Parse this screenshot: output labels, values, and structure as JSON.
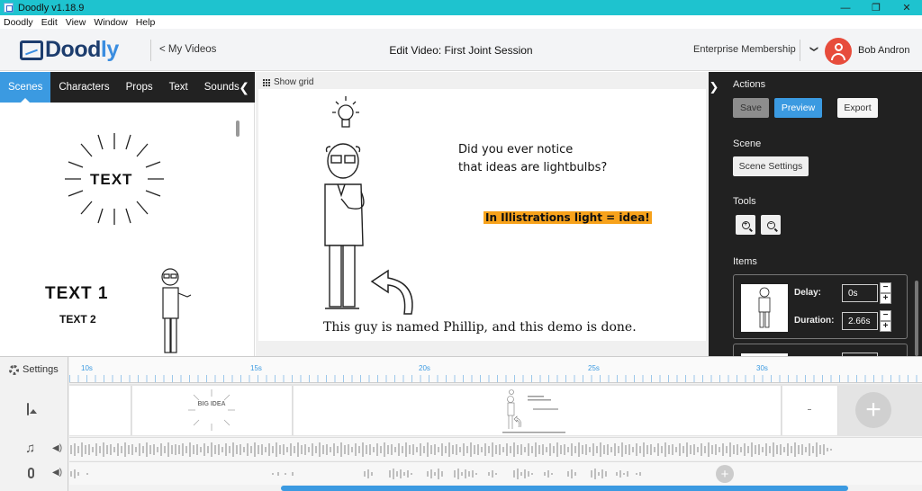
{
  "window": {
    "title": "Doodly v1.18.9",
    "min": "—",
    "max": "❐",
    "close": "✕"
  },
  "menu": [
    "Doodly",
    "Edit",
    "View",
    "Window",
    "Help"
  ],
  "header": {
    "logo_text_a": "Dood",
    "logo_text_b": "ly",
    "back_link": "< My Videos",
    "edit_title": "Edit Video: First Joint Session",
    "membership": "Enterprise Membership",
    "chevron": "❯",
    "user_name": "Bob Andron"
  },
  "left_panel": {
    "tabs": [
      "Scenes",
      "Characters",
      "Props",
      "Text",
      "Sounds"
    ],
    "active_tab": "Scenes",
    "collapse": "❮",
    "samples": {
      "text_burst": "TEXT",
      "text1": "TEXT 1",
      "text2": "TEXT 2"
    }
  },
  "canvas": {
    "show_grid": "Show grid",
    "line1": "Did you ever notice",
    "line2": "that ideas are lightbulbs?",
    "highlight": "In Illistrations light = idea!",
    "caption": "This guy is named Phillip, and this demo is done."
  },
  "right_panel": {
    "toggle": "❯",
    "actions_heading": "Actions",
    "save": "Save",
    "preview": "Preview",
    "export": "Export",
    "scene_heading": "Scene",
    "scene_settings": "Scene Settings",
    "tools_heading": "Tools",
    "zoom_in_glyph": "+",
    "zoom_out_glyph": "−",
    "items_heading": "Items",
    "item": {
      "delay_label": "Delay:",
      "delay_value": "0s",
      "duration_label": "Duration:",
      "duration_value": "2.66s",
      "minus": "−",
      "plus": "+"
    }
  },
  "timeline": {
    "settings": "Settings",
    "ticks": [
      "10s",
      "15s",
      "20s",
      "25s",
      "30s"
    ],
    "scene_thumb_text": "BIG IDEA",
    "add": "+",
    "speaker": "◀)"
  },
  "colors": {
    "accent": "#3b9ae1",
    "titlebar": "#1ec3cf",
    "avatar": "#e74c3c",
    "highlight": "#f7a21b",
    "panel_dark": "#212121"
  }
}
